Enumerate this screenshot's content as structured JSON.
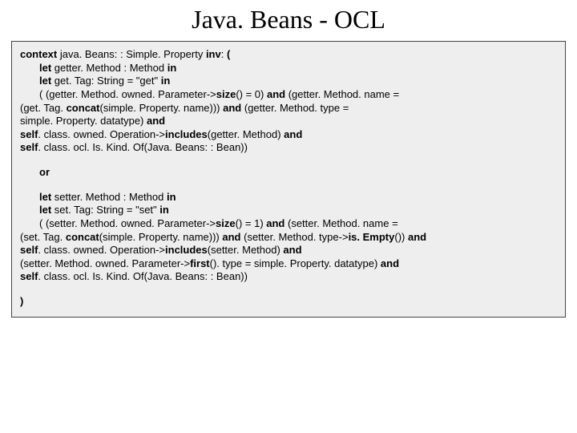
{
  "title": "Java. Beans - OCL",
  "block1": {
    "l1_a": "context",
    "l1_b": " java. Beans: : Simple. Property ",
    "l1_c": "inv",
    "l1_d": ": ",
    "l1_e": "(",
    "l2_a": "let",
    "l2_b": " getter. Method : Method ",
    "l2_c": "in",
    "l3_a": "let",
    "l3_b": " get. Tag: String = \"get\"   ",
    "l3_c": "in",
    "l4_a": "( (getter. Method. owned. Parameter->",
    "l4_b": "size",
    "l4_c": "() = 0) ",
    "l4_d": "and",
    "l4_e": " (getter. Method. name = ",
    "l5_a": "(get. Tag. ",
    "l5_b": "concat",
    "l5_c": "(simple. Property. name))) ",
    "l5_d": "and",
    "l5_e": " (getter. Method. type = ",
    "l6_a": "simple. Property. datatype) ",
    "l6_b": "and",
    "l7_a": "self",
    "l7_b": ". class. owned. Operation->",
    "l7_c": "includes",
    "l7_d": "(getter. Method) ",
    "l7_e": "and",
    "l8_a": "self",
    "l8_b": ". class. ocl. Is. Kind. Of(Java. Beans: : Bean))"
  },
  "or": "or",
  "block2": {
    "l1_a": "let",
    "l1_b": " setter. Method : Method ",
    "l1_c": "in",
    "l2_a": "let",
    "l2_b": " set. Tag: String = \"set\"   ",
    "l2_c": "in",
    "l3_a": "( (setter. Method. owned. Parameter->",
    "l3_b": "size",
    "l3_c": "() = 1) ",
    "l3_d": "and",
    "l3_e": " (setter. Method. name = ",
    "l4_a": "(set. Tag. ",
    "l4_b": "concat",
    "l4_c": "(simple. Property. name))) ",
    "l4_d": "and",
    "l4_e": " (setter. Method. type->",
    "l4_f": "is. Empty",
    "l4_g": "()) ",
    "l4_h": "and",
    "l5_a": "self",
    "l5_b": ". class. owned. Operation->",
    "l5_c": "includes",
    "l5_d": "(setter. Method) ",
    "l5_e": "and",
    "l6_a": "(setter. Method. owned. Parameter->",
    "l6_b": "first",
    "l6_c": "(). type = simple. Property. datatype) ",
    "l6_d": "and",
    "l7_a": "self",
    "l7_b": ". class. ocl. Is. Kind. Of(Java. Beans: : Bean))"
  },
  "close": ")"
}
